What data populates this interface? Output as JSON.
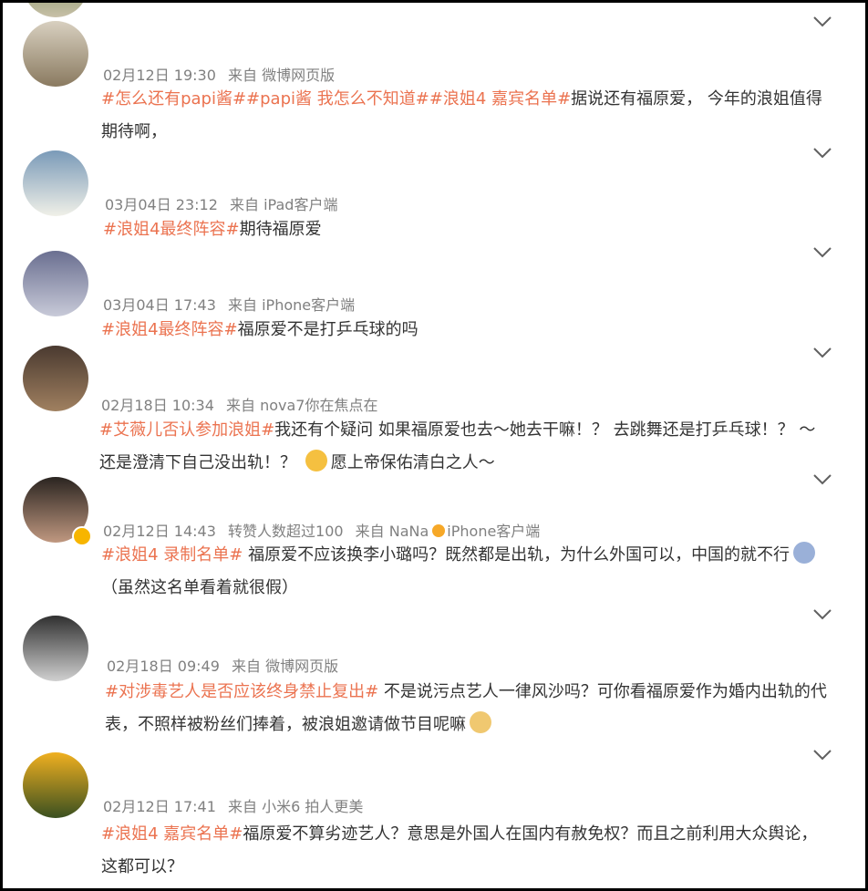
{
  "posts": [
    {
      "time": "",
      "source": "",
      "text": [],
      "avatar": {
        "bg": "linear-gradient(#5a7a3a,#c8c0a8)"
      }
    },
    {
      "time": "02月12日 19:30",
      "source": "来自 微博网页版",
      "text": [
        {
          "t": "#怎么还有papi酱#",
          "tag": true
        },
        {
          "t": "#papi酱 我怎么不知道#",
          "tag": true
        },
        {
          "t": "#浪姐4 嘉宾名单#",
          "tag": true
        },
        {
          "t": "据说还有福原爱， 今年的浪姐值得期待啊，",
          "tag": false
        }
      ],
      "avatar": {
        "bg": "linear-gradient(#d8d0c0,#8a7a60)"
      }
    },
    {
      "time": "03月04日 23:12",
      "source": "来自 iPad客户端",
      "text": [
        {
          "t": "#浪姐4最终阵容#",
          "tag": true
        },
        {
          "t": "期待福原爱",
          "tag": false
        }
      ],
      "avatar": {
        "bg": "linear-gradient(#7a9ab8,#f0f0e8)"
      }
    },
    {
      "time": "03月04日 17:43",
      "source": "来自 iPhone客户端",
      "text": [
        {
          "t": "#浪姐4最终阵容#",
          "tag": true
        },
        {
          "t": "福原爱不是打乒乓球的吗",
          "tag": false
        }
      ],
      "avatar": {
        "bg": "linear-gradient(#6a6f90,#c8cad8)"
      }
    },
    {
      "time": "02月18日 10:34",
      "source": "来自 nova7你在焦点在",
      "text": [
        {
          "t": "#艾薇儿否认参加浪姐#",
          "tag": true
        },
        {
          "t": "我还有个疑问 如果福原爱也去～她去干嘛！？ 去跳舞还是打乒乓球！？ ～还是澄清下自己没出轨！？ ",
          "tag": false
        },
        {
          "t": "emoji",
          "emoji": "#f5c040"
        },
        {
          "t": "愿上帝保佑清白之人～",
          "tag": false
        }
      ],
      "avatar": {
        "bg": "linear-gradient(#4a3a30,#a08060)"
      }
    },
    {
      "time": "02月12日 14:43",
      "extra": "转赞人数超过100",
      "source": "来自 NaNa",
      "source2": "iPhone客户端",
      "text": [
        {
          "t": "#浪姐4 录制名单#",
          "tag": true
        },
        {
          "t": " 福原爱不应该换李小璐吗？既然都是出轨，为什么外国可以，中国的就不行",
          "tag": false
        },
        {
          "t": "emoji",
          "emoji": "#9ab0d8"
        },
        {
          "t": "（虽然这名单看着就很假）",
          "tag": false
        }
      ],
      "avatar": {
        "bg": "linear-gradient(#2a2420,#c09880)"
      }
    },
    {
      "time": "02月18日 09:49",
      "source": "来自 微博网页版",
      "text": [
        {
          "t": "#对涉毒艺人是否应该终身禁止复出#",
          "tag": true
        },
        {
          "t": " 不是说污点艺人一律风沙吗？可你看福原爱作为婚内出轨的代表，不照样被粉丝们捧着，被浪姐邀请做节目呢嘛",
          "tag": false
        },
        {
          "t": "emoji",
          "emoji": "#f0c870"
        }
      ],
      "avatar": {
        "bg": "linear-gradient(#303030,#d0d0d0)"
      }
    },
    {
      "time": "02月12日 17:41",
      "source": "来自 小米6 拍人更美",
      "text": [
        {
          "t": "#浪姐4 嘉宾名单#",
          "tag": true
        },
        {
          "t": "福原爱不算劣迹艺人？意思是外国人在国内有赦免权？而且之前利用大众舆论，这都可以？",
          "tag": false
        }
      ],
      "avatar": {
        "bg": "linear-gradient(#f0b020,#3a5020)"
      }
    }
  ],
  "icons": {
    "chevron": "chevron-down-icon",
    "verified": "verified-badge-icon",
    "sun": "sun-icon"
  },
  "colors": {
    "tag": "#eb7350",
    "meta": "#808080",
    "text": "#333333"
  }
}
